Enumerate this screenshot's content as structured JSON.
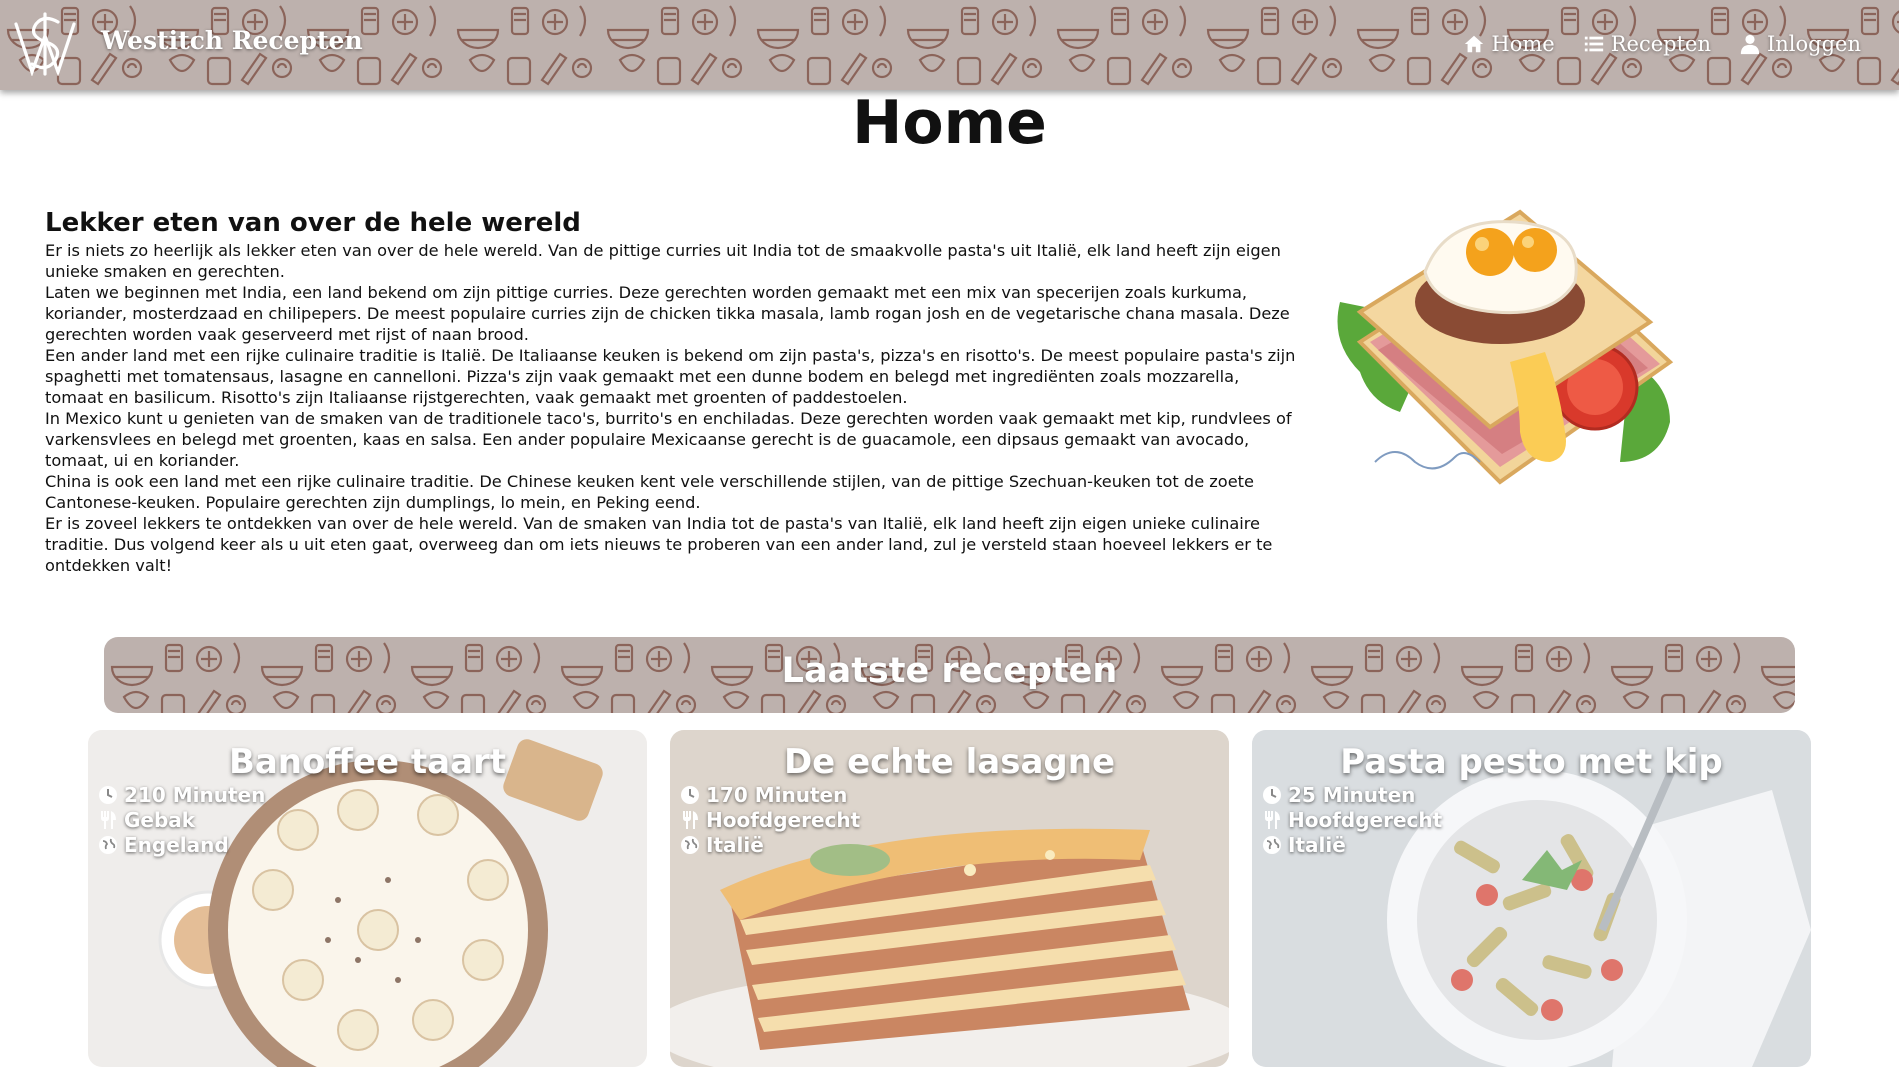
{
  "header": {
    "site_title": "Westitch Recepten",
    "nav": [
      {
        "label": "Home",
        "icon": "home-icon"
      },
      {
        "label": "Recepten",
        "icon": "list-icon"
      },
      {
        "label": "Inloggen",
        "icon": "user-icon"
      }
    ]
  },
  "main": {
    "page_title": "Home",
    "intro_heading": "Lekker eten van over de hele wereld",
    "paragraphs": [
      "Er is niets zo heerlijk als lekker eten van over de hele wereld. Van de pittige curries uit India tot de smaakvolle pasta's uit Italië, elk land heeft zijn eigen unieke smaken en gerechten.",
      "Laten we beginnen met India, een land bekend om zijn pittige curries. Deze gerechten worden gemaakt met een mix van specerijen zoals kurkuma, koriander, mosterdzaad en chilipepers. De meest populaire curries zijn de chicken tikka masala, lamb rogan josh en de vegetarische chana masala. Deze gerechten worden vaak geserveerd met rijst of naan brood.",
      "Een ander land met een rijke culinaire traditie is Italië. De Italiaanse keuken is bekend om zijn pasta's, pizza's en risotto's. De meest populaire pasta's zijn spaghetti met tomatensaus, lasagne en cannelloni. Pizza's zijn vaak gemaakt met een dunne bodem en belegd met ingrediënten zoals mozzarella, tomaat en basilicum. Risotto's zijn Italiaanse rijstgerechten, vaak gemaakt met groenten of paddestoelen.",
      "In Mexico kunt u genieten van de smaken van de traditionele taco's, burrito's en enchiladas. Deze gerechten worden vaak gemaakt met kip, rundvlees of varkensvlees en belegd met groenten, kaas en salsa. Een ander populaire Mexicaanse gerecht is de guacamole, een dipsaus gemaakt van avocado, tomaat, ui en koriander.",
      "China is ook een land met een rijke culinaire traditie. De Chinese keuken kent vele verschillende stijlen, van de pittige Szechuan-keuken tot de zoete Cantonese-keuken. Populaire gerechten zijn dumplings, lo mein, en Peking eend.",
      "Er is zoveel lekkers te ontdekken van over de hele wereld. Van de smaken van India tot de pasta's van Italië, elk land heeft zijn eigen unieke culinaire traditie. Dus volgend keer als u uit eten gaat, overweeg dan om iets nieuws te proberen van een ander land, zul je versteld staan hoeveel lekkers er te ontdekken valt!"
    ]
  },
  "latest": {
    "title": "Laatste recepten",
    "cards": [
      {
        "title": "Banoffee taart",
        "time": "210 Minuten",
        "category": "Gebak",
        "country": "Engeland"
      },
      {
        "title": "De echte lasagne",
        "time": "170 Minuten",
        "category": "Hoofdgerecht",
        "country": "Italië"
      },
      {
        "title": "Pasta pesto met kip",
        "time": "25 Minuten",
        "category": "Hoofdgerecht",
        "country": "Italië"
      }
    ]
  },
  "colors": {
    "banner_bg": "#bdb1ad",
    "pattern": "#7a4a3e",
    "text": "#111111"
  }
}
